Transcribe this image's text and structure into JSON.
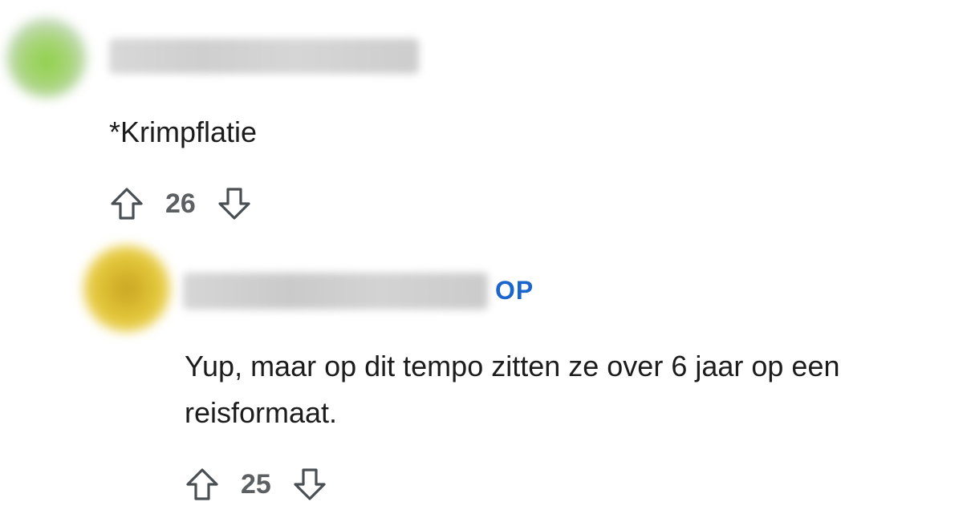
{
  "comment_1": {
    "body": "*Krimpflatie",
    "votes": "26"
  },
  "comment_2": {
    "op_badge": "OP",
    "body": "Yup, maar op dit tempo zitten ze over 6 jaar op een reisformaat.",
    "votes": "25"
  },
  "icons": {
    "upvote": "arrow-up-outline-icon",
    "downvote": "arrow-down-outline-icon"
  },
  "colors": {
    "op_badge": "#1a66cc",
    "vote_count": "#5c6063",
    "icon_stroke": "#4a4f54"
  }
}
